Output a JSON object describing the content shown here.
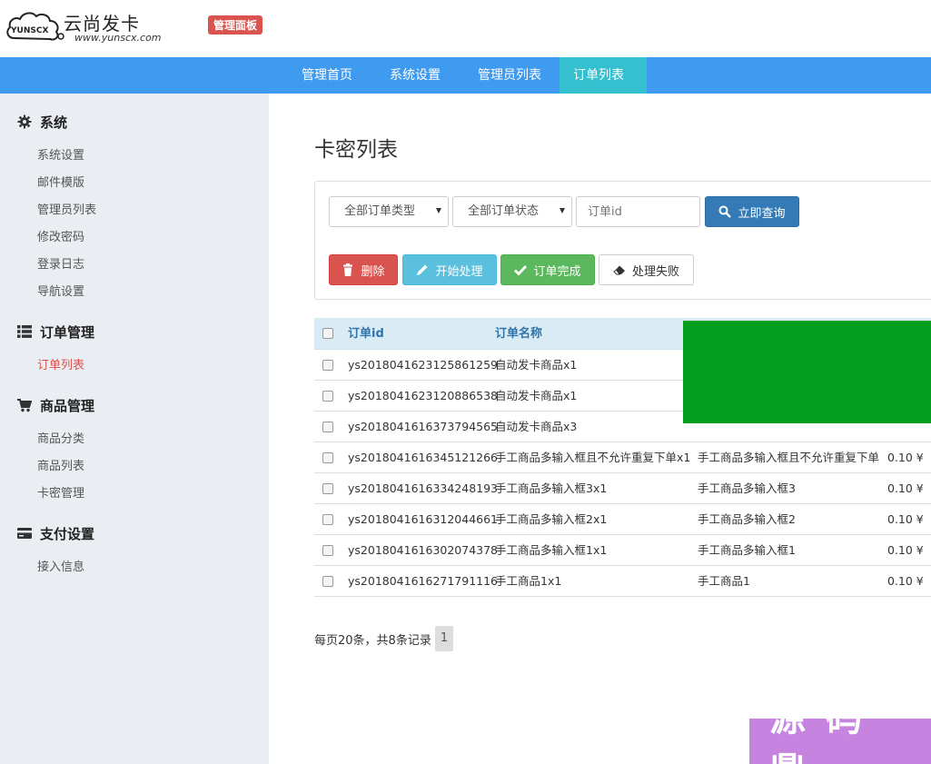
{
  "header": {
    "logo_badge": "YUNSCX",
    "logo_title": "云尚发卡",
    "logo_url": "www.yunscx.com",
    "admin_badge": "管理面板"
  },
  "nav": {
    "items": [
      {
        "label": "管理首页"
      },
      {
        "label": "系统设置"
      },
      {
        "label": "管理员列表"
      },
      {
        "label": "订单列表"
      }
    ],
    "active_index": 3,
    "color": "#3f9bef",
    "active_color": "#35c0cf"
  },
  "sidebar": {
    "groups": [
      {
        "title": "系统",
        "icon": "gear-icon",
        "items": [
          "系统设置",
          "邮件模版",
          "管理员列表",
          "修改密码",
          "登录日志",
          "导航设置"
        ]
      },
      {
        "title": "订单管理",
        "icon": "list-icon",
        "items": [
          "订单列表"
        ]
      },
      {
        "title": "商品管理",
        "icon": "cart-icon",
        "items": [
          "商品分类",
          "商品列表",
          "卡密管理"
        ]
      },
      {
        "title": "支付设置",
        "icon": "credit-card-icon",
        "items": [
          "接入信息"
        ]
      }
    ],
    "active_item": "订单列表",
    "active_color": "#d9534f"
  },
  "main": {
    "page_title": "卡密列表",
    "filters": {
      "order_type": "全部订单类型",
      "order_status": "全部订单状态",
      "order_id_placeholder": "订单id",
      "search_button": "立即查询"
    },
    "actions": {
      "delete": "删除",
      "start": "开始处理",
      "complete": "订单完成",
      "fail": "处理失败"
    },
    "table": {
      "headers": [
        "订单id",
        "订单名称"
      ],
      "rows": [
        {
          "id": "ys2018041623125861259",
          "name": "自动发卡商品x1",
          "product": "",
          "price": ""
        },
        {
          "id": "ys2018041623120886538",
          "name": "自动发卡商品x1",
          "product": "",
          "price": ""
        },
        {
          "id": "ys2018041616373794565",
          "name": "自动发卡商品x3",
          "product": "",
          "price": ""
        },
        {
          "id": "ys2018041616345121266",
          "name": "手工商品多输入框且不允许重复下单x1",
          "product": "手工商品多输入框且不允许重复下单",
          "price": "0.10 ¥"
        },
        {
          "id": "ys2018041616334248193",
          "name": "手工商品多输入框3x1",
          "product": "手工商品多输入框3",
          "price": "0.10 ¥"
        },
        {
          "id": "ys2018041616312044661",
          "name": "手工商品多输入框2x1",
          "product": "手工商品多输入框2",
          "price": "0.10 ¥"
        },
        {
          "id": "ys2018041616302074378",
          "name": "手工商品多输入框1x1",
          "product": "手工商品多输入框1",
          "price": "0.10 ¥"
        },
        {
          "id": "ys2018041616271791116",
          "name": "手工商品1x1",
          "product": "手工商品1",
          "price": "0.10 ¥"
        }
      ]
    },
    "pagination": {
      "summary": "每页20条，共8条记录",
      "current_page": "1"
    }
  },
  "watermark": {
    "text": "源码鼎",
    "color": "#c683e0"
  },
  "overlay_color": "#029e1e"
}
